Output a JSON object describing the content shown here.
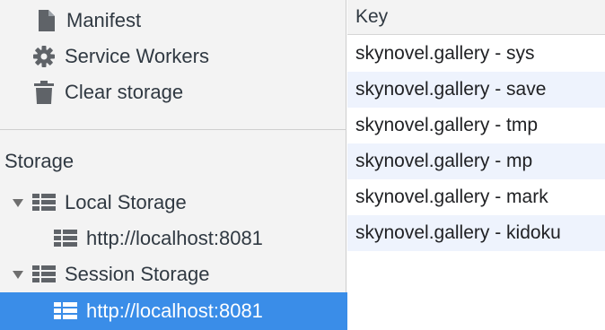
{
  "sidebar": {
    "items": [
      {
        "label": "Manifest",
        "icon": "document-icon"
      },
      {
        "label": "Service Workers",
        "icon": "gear-icon"
      },
      {
        "label": "Clear storage",
        "icon": "trash-icon"
      }
    ],
    "storage_section": {
      "title": "Storage",
      "local_storage": {
        "label": "Local Storage",
        "icon": "table-icon",
        "expanded": true,
        "children": [
          {
            "label": "http://localhost:8081"
          }
        ]
      },
      "session_storage": {
        "label": "Session Storage",
        "icon": "table-icon",
        "expanded": true,
        "children": [
          {
            "label": "http://localhost:8081",
            "selected": true
          }
        ]
      }
    }
  },
  "table": {
    "columns": [
      "Key"
    ],
    "rows": [
      {
        "key": "skynovel.gallery - sys"
      },
      {
        "key": "skynovel.gallery - save"
      },
      {
        "key": "skynovel.gallery - tmp"
      },
      {
        "key": "skynovel.gallery - mp"
      },
      {
        "key": "skynovel.gallery - mark"
      },
      {
        "key": "skynovel.gallery - kidoku"
      }
    ]
  },
  "colors": {
    "selection": "#3a8de8",
    "sidebar_bg": "#f3f3f3",
    "row_alt": "#eef3fd",
    "icon": "#5f6368"
  }
}
